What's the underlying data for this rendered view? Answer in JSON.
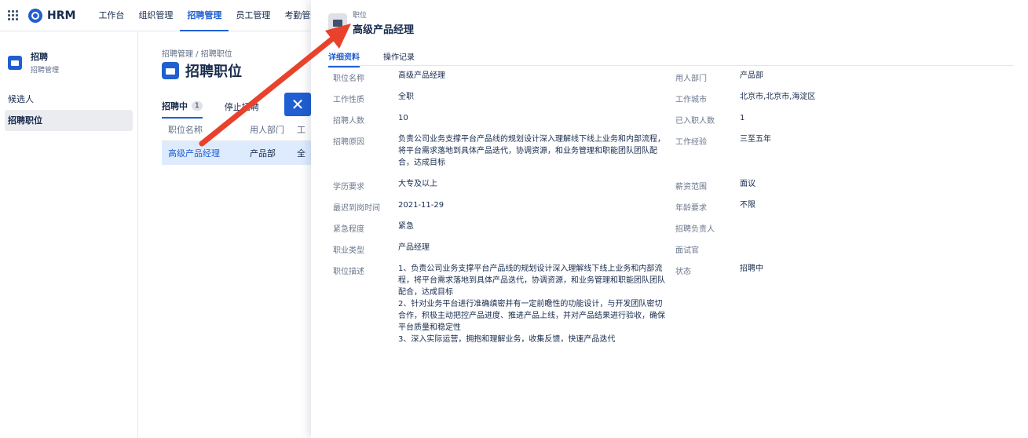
{
  "topnav": {
    "brand": "HRM",
    "items": [
      "工作台",
      "组织管理",
      "招聘管理",
      "员工管理",
      "考勤管理"
    ]
  },
  "sidebar": {
    "title": "招聘",
    "subtitle": "招聘管理",
    "items": [
      "候选人",
      "招聘职位"
    ]
  },
  "main": {
    "breadcrumb": "招聘管理  /  招聘职位",
    "title": "招聘职位",
    "tabs": {
      "active_label": "招聘中",
      "active_count": "1",
      "inactive_label": "停止招聘"
    },
    "close_symbol": "✕",
    "table": {
      "headers": [
        "职位名称",
        "用人部门",
        "工"
      ],
      "row": [
        "高级产品经理",
        "产品部",
        "全"
      ]
    }
  },
  "panel": {
    "label": "职位",
    "title": "高级产品经理",
    "tabs": [
      "详细资料",
      "操作记录"
    ],
    "left": [
      {
        "label": "职位名称",
        "value": "高级产品经理"
      },
      {
        "label": "工作性质",
        "value": "全职"
      },
      {
        "label": "招聘人数",
        "value": "10"
      },
      {
        "label": "招聘原因",
        "value": "负责公司业务支撑平台产品线的规划设计深入理解线下线上业务和内部流程，将平台需求落地到具体产品迭代，协调资源，和业务管理和职能团队团队配合，达成目标"
      },
      {
        "label": "学历要求",
        "value": "大专及以上"
      },
      {
        "label": "最迟到岗时间",
        "value": "2021-11-29"
      },
      {
        "label": "紧急程度",
        "value": "紧急"
      },
      {
        "label": "职业类型",
        "value": "产品经理"
      },
      {
        "label": "职位描述",
        "value": "1、负责公司业务支撑平台产品线的规划设计深入理解线下线上业务和内部流程，将平台需求落地到具体产品迭代，协调资源，和业务管理和职能团队团队配合，达成目标\n2、针对业务平台进行准确缜密并有一定前瞻性的功能设计，与开发团队密切合作，积极主动把控产品进度、推进产品上线，并对产品结果进行验收，确保平台质量和稳定性\n3、深入实际运营，拥抱和理解业务，收集反馈，快速产品迭代"
      }
    ],
    "right": [
      {
        "label": "用人部门",
        "value": "产品部"
      },
      {
        "label": "工作城市",
        "value": "北京市,北京市,海淀区"
      },
      {
        "label": "已入职人数",
        "value": "1"
      },
      {
        "label": "工作经验",
        "value": "三至五年"
      },
      {
        "label": "薪资范围",
        "value": "面议"
      },
      {
        "label": "年龄要求",
        "value": "不限"
      },
      {
        "label": "招聘负责人",
        "value": ""
      },
      {
        "label": "面试官",
        "value": ""
      },
      {
        "label": "状态",
        "value": "招聘中"
      }
    ]
  },
  "colors": {
    "accent": "#1f5fd1",
    "annotation_arrow": "#e8412c",
    "selected_row": "#deebff"
  }
}
